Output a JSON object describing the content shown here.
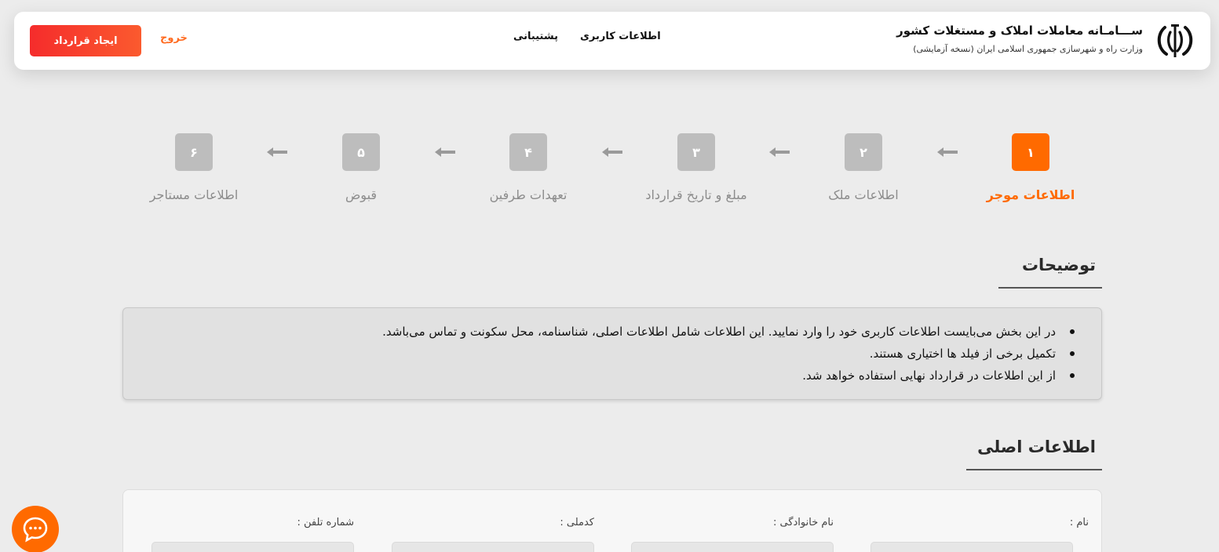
{
  "header": {
    "title": "ســـامـانه معاملات املاک و مستغلات کشور",
    "subtitle": "وزارت راه و شهرسازی جمهوری اسلامی ایران (نسخه آزمایشی)",
    "nav": {
      "user_info": "اطلاعات کاربری",
      "support": "پشتیبانی"
    },
    "exit_label": "خروج",
    "create_contract_label": "ایجاد قرارداد"
  },
  "steps": [
    {
      "number": "۱",
      "label": "اطلاعات موجر",
      "active": true
    },
    {
      "number": "۲",
      "label": "اطلاعات ملک",
      "active": false
    },
    {
      "number": "۳",
      "label": "مبلغ و تاریخ قرارداد",
      "active": false
    },
    {
      "number": "۴",
      "label": "تعهدات طرفین",
      "active": false
    },
    {
      "number": "۵",
      "label": "قبوض",
      "active": false
    },
    {
      "number": "۶",
      "label": "اطلاعات مستاجر",
      "active": false
    }
  ],
  "description": {
    "title": "توضیحات",
    "items": [
      "در این بخش می‌بایست اطلاعات کاربری خود را وارد نمایید. این اطلاعات شامل اطلاعات اصلی، شناسنامه، محل سکونت و تماس می‌باشد.",
      "تکمیل برخی از فیلد ها اختیاری هستند.",
      "از این اطلاعات در قرارداد نهایی استفاده خواهد شد."
    ]
  },
  "main_info": {
    "title": "اطلاعات اصلی",
    "fields": {
      "first_name": "نام :",
      "last_name": "نام خانوادگی :",
      "national_code": "کدملی :",
      "phone": "شماره تلفن :"
    }
  },
  "colors": {
    "accent": "#ff6a00",
    "create_button_start": "#f52c2c",
    "create_button_end": "#fb5a2e",
    "step_inactive": "#bdbdbd",
    "background": "#ececec"
  },
  "icons": {
    "emblem": "iran-emblem-icon",
    "chat": "chat-bubble-icon",
    "arrow": "arrow-left-icon"
  }
}
